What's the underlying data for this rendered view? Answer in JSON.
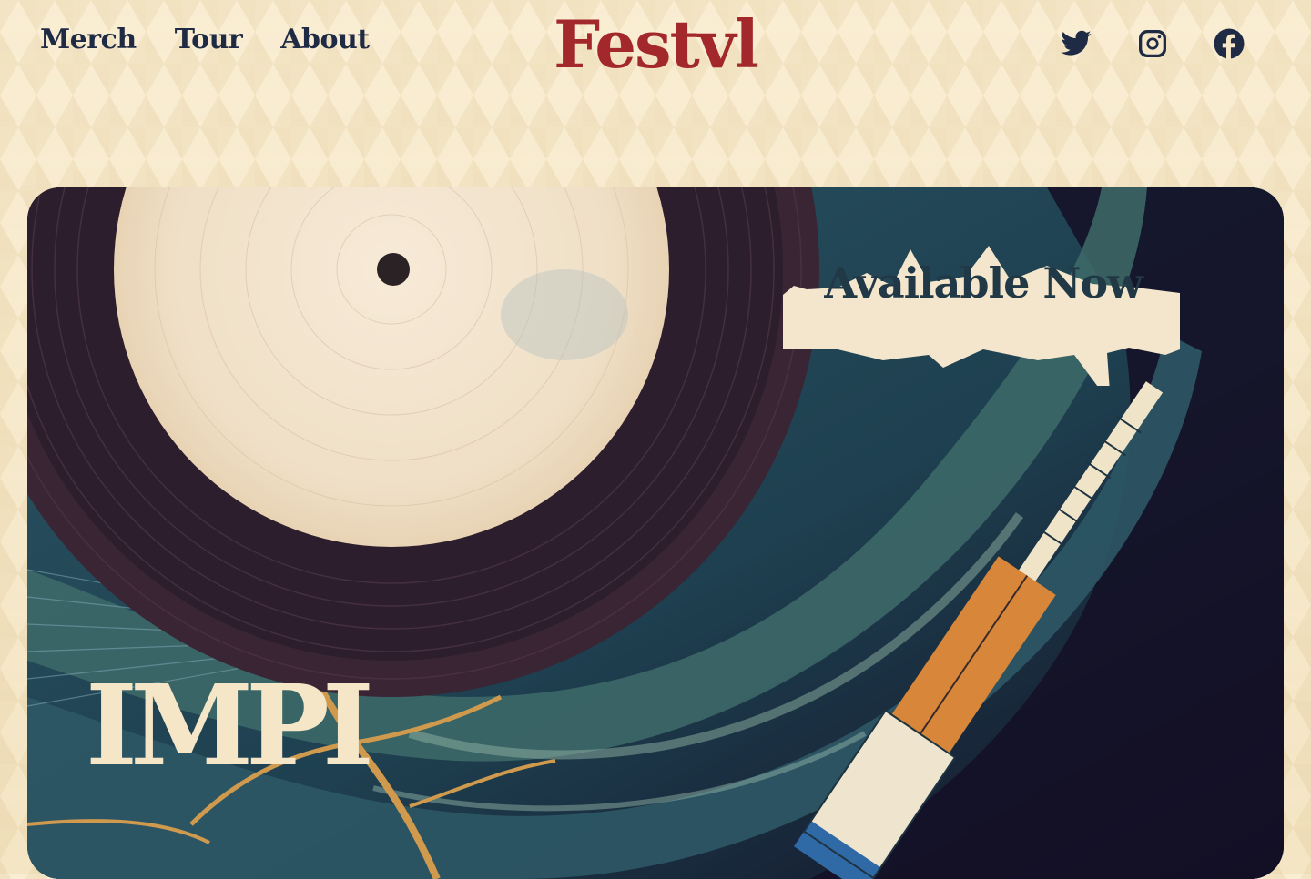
{
  "brand": {
    "name": "Festvl",
    "color": "#a3282b"
  },
  "nav": {
    "items": [
      {
        "label": "Merch"
      },
      {
        "label": "Tour"
      },
      {
        "label": "About"
      }
    ]
  },
  "social": {
    "icons": [
      "twitter-icon",
      "instagram-icon",
      "facebook-icon"
    ]
  },
  "hero": {
    "title": "IMPI",
    "badge": "Available Now",
    "image": "vinyl-turntable-illustration"
  },
  "colors": {
    "nav_text": "#1f2b45",
    "cream": "#f5e6c8",
    "background": "#f6e7c8"
  }
}
